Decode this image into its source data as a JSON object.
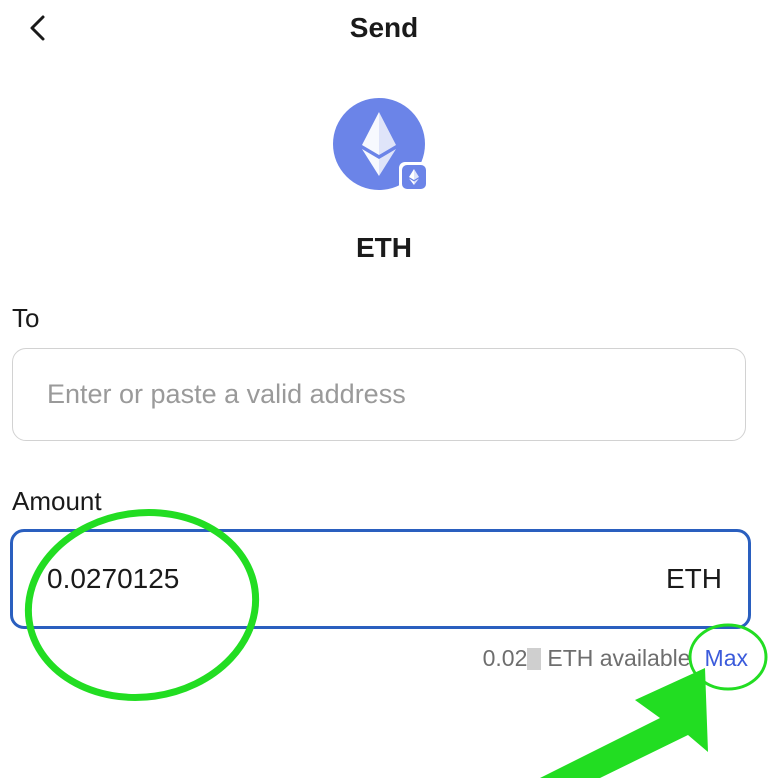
{
  "header": {
    "title": "Send",
    "back_icon": "chevron-left-icon"
  },
  "token": {
    "symbol": "ETH",
    "icon": "ethereum-icon",
    "network_badge_icon": "ethereum-network-badge-icon",
    "color": "#6b84e8"
  },
  "to": {
    "label": "To",
    "placeholder": "Enter or paste a valid address"
  },
  "amount": {
    "label": "Amount",
    "value": "0.0270125",
    "unit": "ETH",
    "border_color": "#2a5fbf"
  },
  "balance": {
    "prefix": "0.02",
    "suffix": "ETH available",
    "max_label": "Max",
    "max_color": "#3b5bdb"
  },
  "annotations": {
    "highlight_color": "#22dd22"
  }
}
